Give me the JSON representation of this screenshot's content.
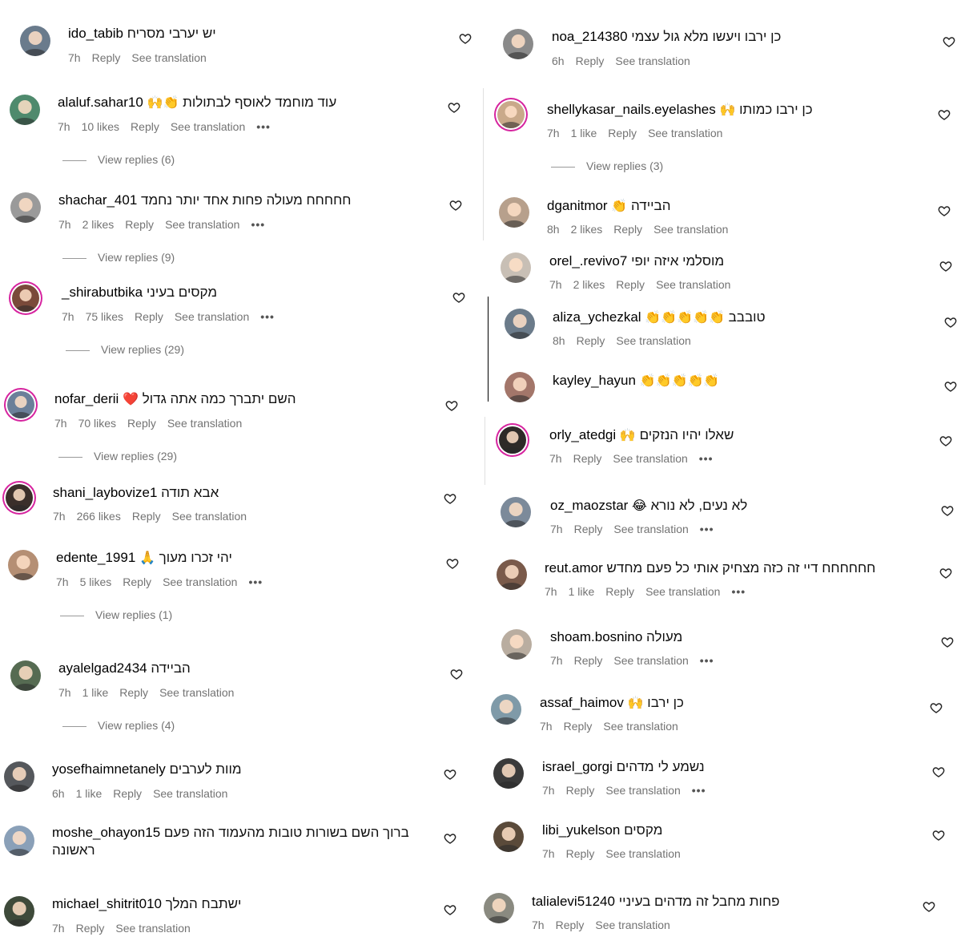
{
  "left_comments": [
    {
      "username": "ido_tabib",
      "text": "יש יערבי מסריח",
      "time": "7h",
      "likes": "",
      "reply": "Reply",
      "see_translation": "See translation",
      "more": false,
      "view_replies": "",
      "avatar_color": "#6a7b8c"
    },
    {
      "username": "alaluf.sahar10",
      "text": "עוד מוחמד לאוסף לבתולות",
      "emoji": "🙌👏",
      "time": "7h",
      "likes": "10 likes",
      "reply": "Reply",
      "see_translation": "See translation",
      "more": true,
      "view_replies": "View replies (6)",
      "avatar_color": "#4f8a6d"
    },
    {
      "username": "shachar_401",
      "text": "חחחחח מעולה פחות אחד יותר נחמד",
      "time": "7h",
      "likes": "2 likes",
      "reply": "Reply",
      "see_translation": "See translation",
      "more": true,
      "view_replies": "View replies (9)",
      "avatar_color": "#9a9a9a"
    },
    {
      "username": "_shirabutbika",
      "text": "מקסים בעיני",
      "time": "7h",
      "likes": "75 likes",
      "reply": "Reply",
      "see_translation": "See translation",
      "more": true,
      "view_replies": "View replies (29)",
      "avatar_color": "#7a4a3a",
      "ring": true
    },
    {
      "username": "nofar_derii",
      "text": "השם יתברך כמה אתה גדול",
      "emoji": "❤️",
      "time": "7h",
      "likes": "70 likes",
      "reply": "Reply",
      "see_translation": "See translation",
      "more": false,
      "view_replies": "View replies (29)",
      "avatar_color": "#6b7f99",
      "ring": true
    },
    {
      "username": "shani_laybovize1",
      "text": "אבא תודה",
      "time": "7h",
      "likes": "266 likes",
      "reply": "Reply",
      "see_translation": "See translation",
      "more": false,
      "view_replies": "",
      "avatar_color": "#3a2e2a",
      "ring": true
    },
    {
      "username": "edente_1991",
      "text": "יהי זכרו מעוך",
      "emoji": "🙏",
      "time": "7h",
      "likes": "5 likes",
      "reply": "Reply",
      "see_translation": "See translation",
      "more": true,
      "view_replies": "View replies (1)",
      "avatar_color": "#b58f74"
    },
    {
      "username": "ayalelgad2434",
      "text": "הביידה",
      "time": "7h",
      "likes": "1 like",
      "reply": "Reply",
      "see_translation": "See translation",
      "more": false,
      "view_replies": "View replies (4)",
      "avatar_color": "#566b52"
    },
    {
      "username": "yosefhaimnetanely",
      "text": "מוות לערבים",
      "time": "6h",
      "likes": "1 like",
      "reply": "Reply",
      "see_translation": "See translation",
      "more": false,
      "view_replies": "",
      "avatar_color": "#55585c"
    },
    {
      "username": "moshe_ohayon15",
      "text": "ברוך השם בשורות טובות מהעמוד הזה פעם",
      "text2": "ראשונה",
      "time": "",
      "likes": "",
      "reply": "",
      "see_translation": "",
      "more": false,
      "view_replies": "",
      "avatar_color": "#8aa0b8"
    },
    {
      "username": "michael_shitrit010",
      "text": "ישתבח המלך",
      "time": "7h",
      "likes": "",
      "reply": "Reply",
      "see_translation": "See translation",
      "more": false,
      "view_replies": "",
      "avatar_color": "#3e4a3a"
    }
  ],
  "right_comments": [
    {
      "username": "noa_214380",
      "text": "כן ירבו ויעשו מלא גול עצמי",
      "time": "6h",
      "likes": "",
      "reply": "Reply",
      "see_translation": "See translation",
      "more": false,
      "view_replies": "",
      "avatar_color": "#8a8a8a"
    },
    {
      "username": "shellykasar_nails.eyelashes",
      "text": "כן ירבו כמותו",
      "emoji": "🙌",
      "time": "7h",
      "likes": "1 like",
      "reply": "Reply",
      "see_translation": "See translation",
      "more": false,
      "view_replies": "View replies (3)",
      "avatar_color": "#c9a98a",
      "ring": true
    },
    {
      "username": "dganitmor",
      "text": "הביידה",
      "emoji": "👏",
      "time": "8h",
      "likes": "2 likes",
      "reply": "Reply",
      "see_translation": "See translation",
      "more": false,
      "view_replies": "",
      "avatar_color": "#b7a08c"
    },
    {
      "username": "orel_.revivo7",
      "text": "מוסלמי איזה יופי",
      "time": "7h",
      "likes": "2 likes",
      "reply": "Reply",
      "see_translation": "See translation",
      "more": false,
      "view_replies": "",
      "avatar_color": "#c8bfb5"
    },
    {
      "username": "aliza_ychezkal",
      "text": "טובבב",
      "emoji": "👏👏👏👏👏",
      "time": "8h",
      "likes": "",
      "reply": "Reply",
      "see_translation": "See translation",
      "more": false,
      "view_replies": "",
      "avatar_color": "#6b7b8a"
    },
    {
      "username": "kayley_hayun",
      "text": "",
      "emoji": "👏👏👏👏👏",
      "time": "",
      "likes": "",
      "reply": "",
      "see_translation": "",
      "more": false,
      "view_replies": "",
      "avatar_color": "#a3766a"
    },
    {
      "username": "orly_atedgi",
      "text": "שאלו יהיו הנזקים",
      "emoji": "🙌",
      "time": "7h",
      "likes": "",
      "reply": "Reply",
      "see_translation": "See translation",
      "more": true,
      "view_replies": "",
      "avatar_color": "#2e2a28",
      "ring": true
    },
    {
      "username": "oz_maozstar",
      "text": "לא נעים, לא נורא",
      "emoji": "😂",
      "time": "7h",
      "likes": "",
      "reply": "Reply",
      "see_translation": "See translation",
      "more": true,
      "view_replies": "",
      "avatar_color": "#7c8a9a"
    },
    {
      "username": "reut.amor",
      "text": "חחחחחח דיי זה כזה מצחיק אותי כל פעם מחדש",
      "time": "7h",
      "likes": "1 like",
      "reply": "Reply",
      "see_translation": "See translation",
      "more": true,
      "view_replies": "",
      "avatar_color": "#7a5a4a"
    },
    {
      "username": "shoam.bosnino",
      "text": "מעולה",
      "time": "7h",
      "likes": "",
      "reply": "Reply",
      "see_translation": "See translation",
      "more": true,
      "view_replies": "",
      "avatar_color": "#b9ada0"
    },
    {
      "username": "assaf_haimov",
      "text": "כן ירבו",
      "emoji": "🙌",
      "time": "7h",
      "likes": "",
      "reply": "Reply",
      "see_translation": "See translation",
      "more": false,
      "view_replies": "",
      "avatar_color": "#7f9aa8"
    },
    {
      "username": "israel_gorgi",
      "text": "נשמע לי מדהים",
      "time": "7h",
      "likes": "",
      "reply": "Reply",
      "see_translation": "See translation",
      "more": true,
      "view_replies": "",
      "avatar_color": "#3a3a3a"
    },
    {
      "username": "libi_yukelson",
      "text": "מקסים",
      "time": "7h",
      "likes": "",
      "reply": "Reply",
      "see_translation": "See translation",
      "more": false,
      "view_replies": "",
      "avatar_color": "#5a4a3a"
    },
    {
      "username": "talialevi51240",
      "text": "פחות מחבל זה מדהים בעיניי",
      "time": "7h",
      "likes": "",
      "reply": "Reply",
      "see_translation": "See translation",
      "more": false,
      "view_replies": "",
      "avatar_color": "#8a8a80"
    }
  ],
  "icons": {
    "like": "heart-outline-icon",
    "more": "more-dots-icon"
  }
}
